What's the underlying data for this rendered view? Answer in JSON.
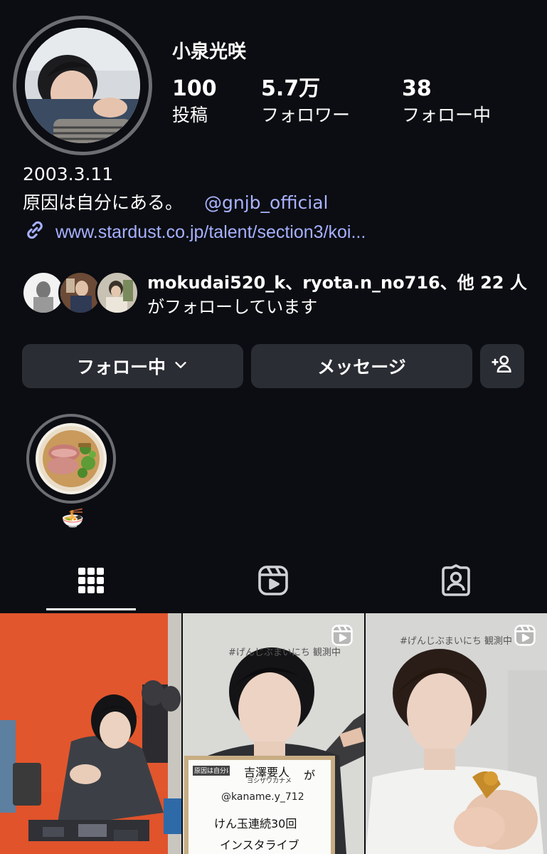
{
  "profile": {
    "username": "小泉光咲",
    "stats": [
      {
        "value": "100",
        "label": "投稿"
      },
      {
        "value": "5.7万",
        "label": "フォロワー"
      },
      {
        "value": "38",
        "label": "フォロー中"
      }
    ],
    "bio_line1": "2003.3.11",
    "bio_line2": "原因は自分にある。",
    "bio_mention": "@gnjb_official",
    "link": "www.stardust.co.jp/talent/section3/koi..."
  },
  "followed_by": {
    "names": "mokudai520_k、ryota.n_no716、",
    "others": "他 22 人",
    "suffix": "がフォローしています"
  },
  "buttons": {
    "following": "フォロー中",
    "message": "メッセージ"
  },
  "highlight": {
    "label": "🍜"
  },
  "tabs": [
    {
      "icon": "grid-icon",
      "active": true
    },
    {
      "icon": "reels-icon",
      "active": false
    },
    {
      "icon": "tagged-icon",
      "active": false
    }
  ],
  "posts": [
    {
      "type": "photo",
      "bg": "#e2562d"
    },
    {
      "type": "reel",
      "bg": "#d9d9d6",
      "wall_caption": "#げんじぶまいにち 観測中",
      "board_brand": "原因は自分にある。",
      "board_name": "吉澤要人",
      "board_name_kana": "ヨシザワカナメ",
      "board_ga": "が",
      "board_handle": "@kaname.y_712",
      "board_line1": "けん玉連続30回",
      "board_line2": "インスタライブ"
    },
    {
      "type": "reel",
      "bg": "#d6d6d4",
      "wall_caption": "#げんじぶまいにち 観測中"
    }
  ],
  "colors": {
    "background": "#0b0d12",
    "button": "#2a2d33",
    "link": "#a6b0ff",
    "ring": "#6c6e73"
  }
}
